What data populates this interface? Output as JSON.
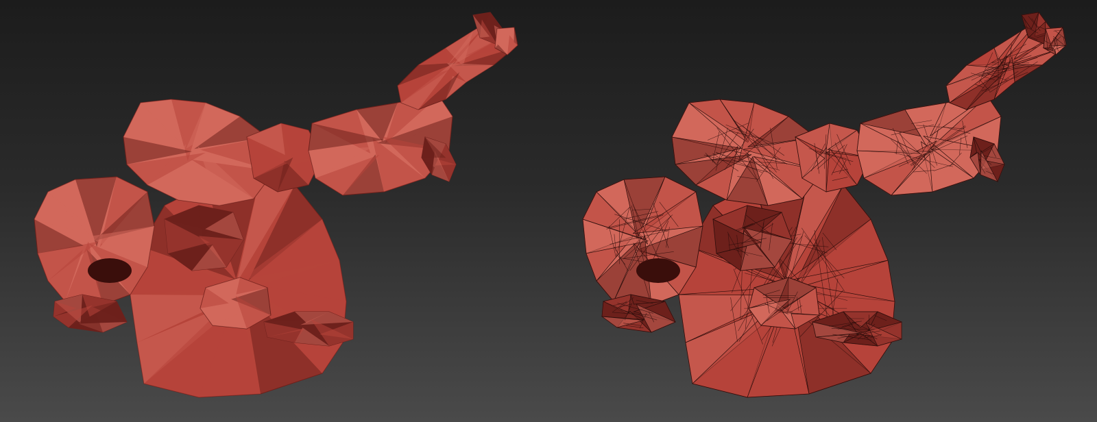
{
  "scene": {
    "background_top": "#1c1c1c",
    "background_bottom": "#4a4a4a",
    "model_color": "#b6443a",
    "model_highlight": "#d2685b",
    "model_shadow": "#6e211c",
    "wire_color": "#2a0d0b"
  },
  "views": [
    {
      "name": "shaded-view",
      "shading": "smooth",
      "wireframe": false
    },
    {
      "name": "wireframe-on-shaded-view",
      "shading": "smooth",
      "wireframe": true
    }
  ]
}
